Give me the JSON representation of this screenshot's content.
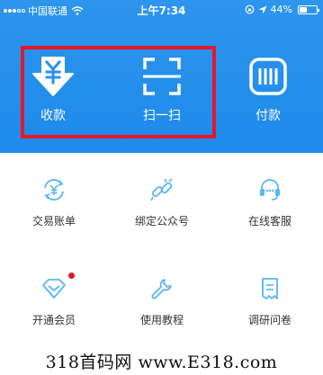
{
  "status_bar": {
    "carrier": "中国联通",
    "time": "上午7:34",
    "battery": "44%",
    "battery_level": 0.44,
    "signal_bars": 3
  },
  "top_actions": [
    {
      "label": "收款",
      "icon": "yuan-down-arrow-icon"
    },
    {
      "label": "扫一扫",
      "icon": "scan-icon"
    },
    {
      "label": "付款",
      "icon": "barcode-icon"
    }
  ],
  "grid": [
    {
      "label": "交易账单",
      "icon": "yuan-cycle-icon",
      "badge": false
    },
    {
      "label": "绑定公众号",
      "icon": "link-icon",
      "badge": false
    },
    {
      "label": "在线客服",
      "icon": "headset-icon",
      "badge": false
    },
    {
      "label": "开通会员",
      "icon": "diamond-icon",
      "badge": true
    },
    {
      "label": "使用教程",
      "icon": "wrench-icon",
      "badge": false
    },
    {
      "label": "调研问卷",
      "icon": "survey-icon",
      "badge": false
    }
  ],
  "watermark": "318首码网 www.E318.com",
  "colors": {
    "header_blue": "#1e8aea",
    "icon_blue": "#56b7f5",
    "highlight_red": "#e4172b"
  }
}
